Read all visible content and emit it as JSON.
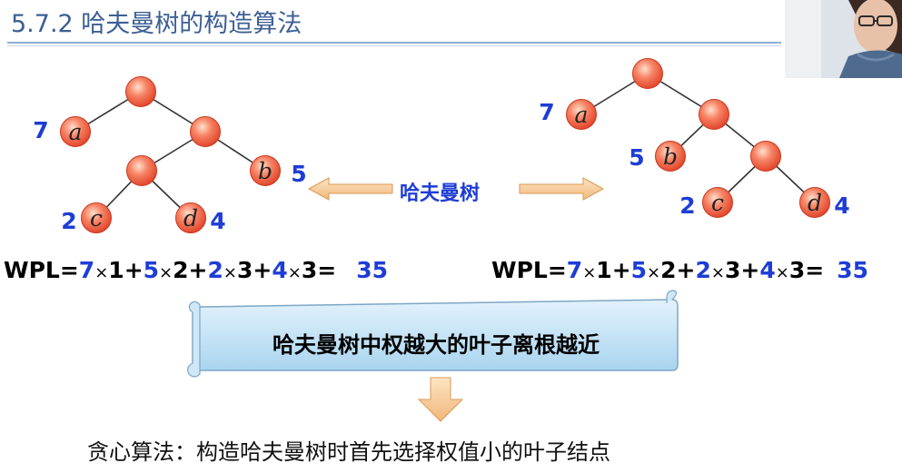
{
  "slide": {
    "title": "5.7.2 哈夫曼树的构造算法",
    "center_label": "哈夫曼树",
    "scroll_text": "哈夫曼树中权越大的叶子离根越近",
    "bottom_text": "贪心算法：构造哈夫曼树时首先选择权值小的叶子结点"
  },
  "trees": [
    {
      "leaves": [
        {
          "letter": "a",
          "weight": "7",
          "depth": 1
        },
        {
          "letter": "b",
          "weight": "5",
          "depth": 2
        },
        {
          "letter": "c",
          "weight": "2",
          "depth": 3
        },
        {
          "letter": "d",
          "weight": "4",
          "depth": 3
        }
      ],
      "wpl": {
        "prefix": "WPL=",
        "terms": [
          {
            "w": "7",
            "d": "1"
          },
          {
            "w": "5",
            "d": "2"
          },
          {
            "w": "2",
            "d": "3"
          },
          {
            "w": "4",
            "d": "3"
          }
        ],
        "times": "×",
        "plus": "+",
        "equals": "=",
        "result": "35"
      }
    },
    {
      "leaves": [
        {
          "letter": "a",
          "weight": "7",
          "depth": 1
        },
        {
          "letter": "b",
          "weight": "5",
          "depth": 2
        },
        {
          "letter": "c",
          "weight": "2",
          "depth": 3
        },
        {
          "letter": "d",
          "weight": "4",
          "depth": 3
        }
      ],
      "wpl": {
        "prefix": "WPL=",
        "terms": [
          {
            "w": "7",
            "d": "1"
          },
          {
            "w": "5",
            "d": "2"
          },
          {
            "w": "2",
            "d": "3"
          },
          {
            "w": "4",
            "d": "3"
          }
        ],
        "times": "×",
        "plus": "+",
        "equals": "=",
        "result": "35"
      }
    }
  ],
  "colors": {
    "title": "#3c5f95",
    "node_fill": "#f2624a",
    "weight_text": "#1e3dd6",
    "arrow_fill": "#f7cfa0",
    "scroll_fill": "#bfe0f4"
  }
}
